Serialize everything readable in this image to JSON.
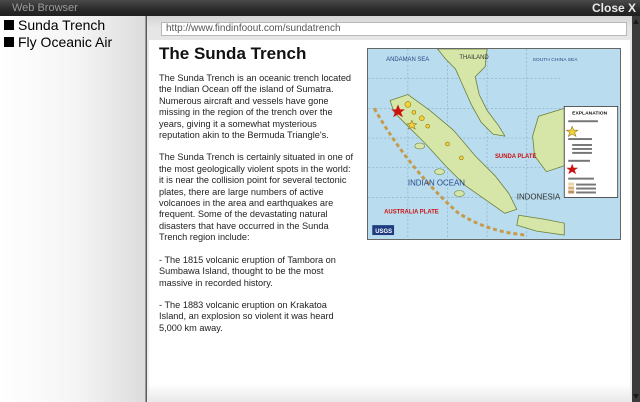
{
  "window": {
    "title": "Web Browser",
    "close_label": "Close X"
  },
  "sidebar": {
    "items": [
      {
        "label": "Sunda Trench"
      },
      {
        "label": "Fly Oceanic Air"
      }
    ]
  },
  "browser": {
    "url": "http://www.findinfoout.com/sundatrench"
  },
  "article": {
    "title": "The Sunda Trench",
    "paragraphs": [
      "The Sunda Trench is an oceanic trench located the Indian Ocean off the island of Sumatra. Numerous aircraft and vessels have gone missing in the region of the trench over the years, giving it a somewhat mysterious reputation akin to the Bermuda Triangle's.",
      "The Sunda Trench is certainly situated in one of the most geologically violent spots in the world: it is near the collision point for several tectonic plates, there are large numbers of active volcanoes in the area and earthquakes are frequent.  Some of the devastating natural disasters that have occurred in the Sunda Trench region include:",
      "- The 1815 volcanic eruption of Tambora on Sumbawa Island, thought to be the most massive in recorded history.",
      "- The 1883 volcanic eruption on Krakatoa Island, an explosion so violent it was heard 5,000 km away."
    ]
  },
  "map": {
    "labels": {
      "andaman_sea": "ANDAMAN SEA",
      "thailand": "THAILAND",
      "south_china_sea": "SOUTH CHINA SEA",
      "indian_ocean": "INDIAN OCEAN",
      "sunda_plate": "SUNDA PLATE",
      "australia_plate": "AUSTRALIA PLATE",
      "indonesia": "INDONESIA",
      "explanation": "EXPLANATION",
      "logo": "USGS"
    },
    "colors": {
      "ocean": "#b9dcee",
      "land": "#d6e6a8",
      "plate_label": "#cc1111"
    }
  }
}
